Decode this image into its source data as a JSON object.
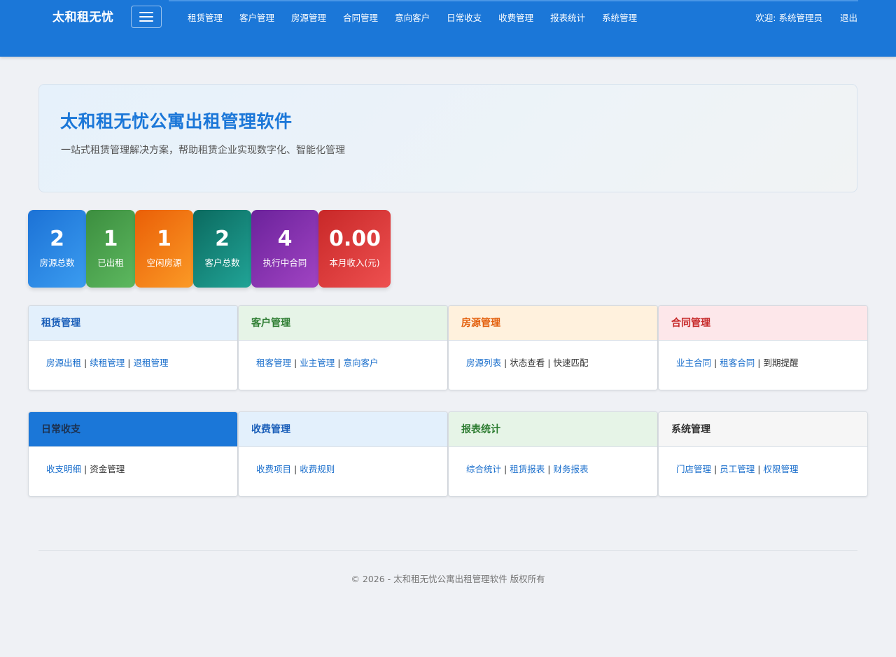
{
  "header": {
    "brand": "太和租无忧",
    "nav": [
      "租赁管理",
      "客户管理",
      "房源管理",
      "合同管理",
      "意向客户",
      "日常收支",
      "收费管理",
      "报表统计",
      "系统管理"
    ],
    "welcome": "欢迎: 系统管理员",
    "logout": "退出",
    "menu_icon": "hamburger-icon",
    "brand_color": "#1b77d8"
  },
  "hero": {
    "title": "太和租无忧公寓出租管理软件",
    "subtitle": "一站式租赁管理解决方案，帮助租赁企业实现数字化、智能化管理"
  },
  "stats": [
    {
      "value": "2",
      "label": "房源总数"
    },
    {
      "value": "1",
      "label": "已出租"
    },
    {
      "value": "1",
      "label": "空闲房源"
    },
    {
      "value": "2",
      "label": "客户总数"
    },
    {
      "value": "4",
      "label": "执行中合同"
    },
    {
      "value": "0.00",
      "label": "本月收入(元)"
    }
  ],
  "modules": [
    {
      "title": "租赁管理",
      "items": [
        {
          "text": "房源出租",
          "link": true
        },
        {
          "text": "续租管理",
          "link": true
        },
        {
          "text": "退租管理",
          "link": true
        }
      ]
    },
    {
      "title": "客户管理",
      "items": [
        {
          "text": "租客管理",
          "link": true
        },
        {
          "text": "业主管理",
          "link": true
        },
        {
          "text": "意向客户",
          "link": true
        }
      ]
    },
    {
      "title": "房源管理",
      "items": [
        {
          "text": "房源列表",
          "link": true
        },
        {
          "text": "状态查看",
          "link": false
        },
        {
          "text": "快速匹配",
          "link": false
        }
      ]
    },
    {
      "title": "合同管理",
      "items": [
        {
          "text": "业主合同",
          "link": true
        },
        {
          "text": "租客合同",
          "link": true
        },
        {
          "text": "到期提醒",
          "link": false
        }
      ]
    },
    {
      "title": "日常收支",
      "items": [
        {
          "text": "收支明细",
          "link": true
        },
        {
          "text": "资金管理",
          "link": false
        }
      ]
    },
    {
      "title": "收费管理",
      "items": [
        {
          "text": "收费项目",
          "link": true
        },
        {
          "text": "收费规则",
          "link": true
        }
      ]
    },
    {
      "title": "报表统计",
      "items": [
        {
          "text": "综合统计",
          "link": true
        },
        {
          "text": "租赁报表",
          "link": true
        },
        {
          "text": "财务报表",
          "link": true
        }
      ]
    },
    {
      "title": "系统管理",
      "items": [
        {
          "text": "门店管理",
          "link": true
        },
        {
          "text": "员工管理",
          "link": true
        },
        {
          "text": "权限管理",
          "link": true
        }
      ]
    }
  ],
  "separator": "|",
  "footer": {
    "text": "© 2026 - 太和租无忧公寓出租管理软件 版权所有"
  }
}
